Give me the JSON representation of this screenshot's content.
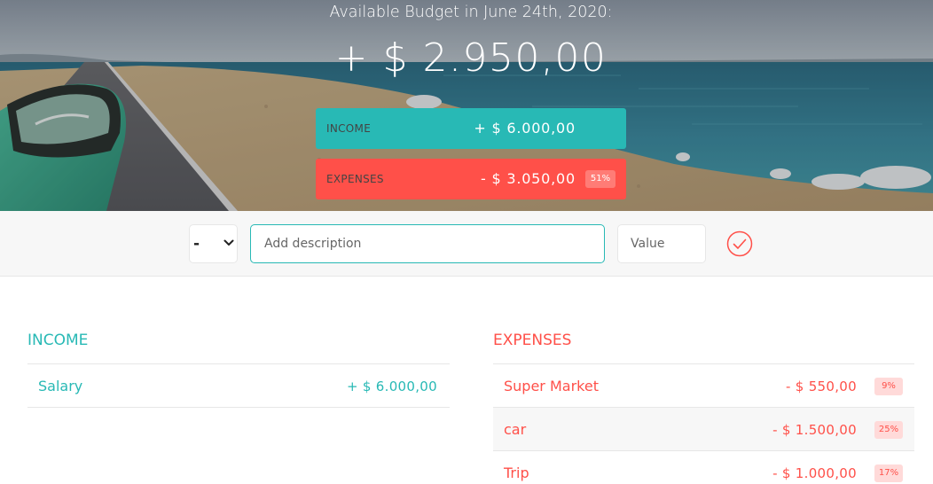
{
  "budget": {
    "title": "Available Budget in June 24th, 2020:",
    "value": "+ $ 2.950,00",
    "income_label": "Income",
    "income_value": "+ $ 6.000,00",
    "expenses_label": "Expenses",
    "expenses_value": "- $ 3.050,00",
    "expenses_percentage": "51%"
  },
  "add": {
    "type_selected": "-",
    "description_placeholder": "Add description",
    "value_placeholder": "Value"
  },
  "income": {
    "title": "Income",
    "items": [
      {
        "description": "Salary",
        "value": "+ $ 6.000,00"
      }
    ]
  },
  "expenses": {
    "title": "Expenses",
    "items": [
      {
        "description": "Super Market",
        "value": "- $ 550,00",
        "percentage": "9%"
      },
      {
        "description": "car",
        "value": "- $ 1.500,00",
        "percentage": "25%"
      },
      {
        "description": "Trip",
        "value": "- $ 1.000,00",
        "percentage": "17%"
      }
    ]
  },
  "colors": {
    "income": "#28b9b5",
    "expenses": "#ff5049"
  },
  "icons": {
    "add_button": "check-circle-icon",
    "select_arrow": "chevron-down-icon",
    "hero": "beach-road-photo"
  }
}
